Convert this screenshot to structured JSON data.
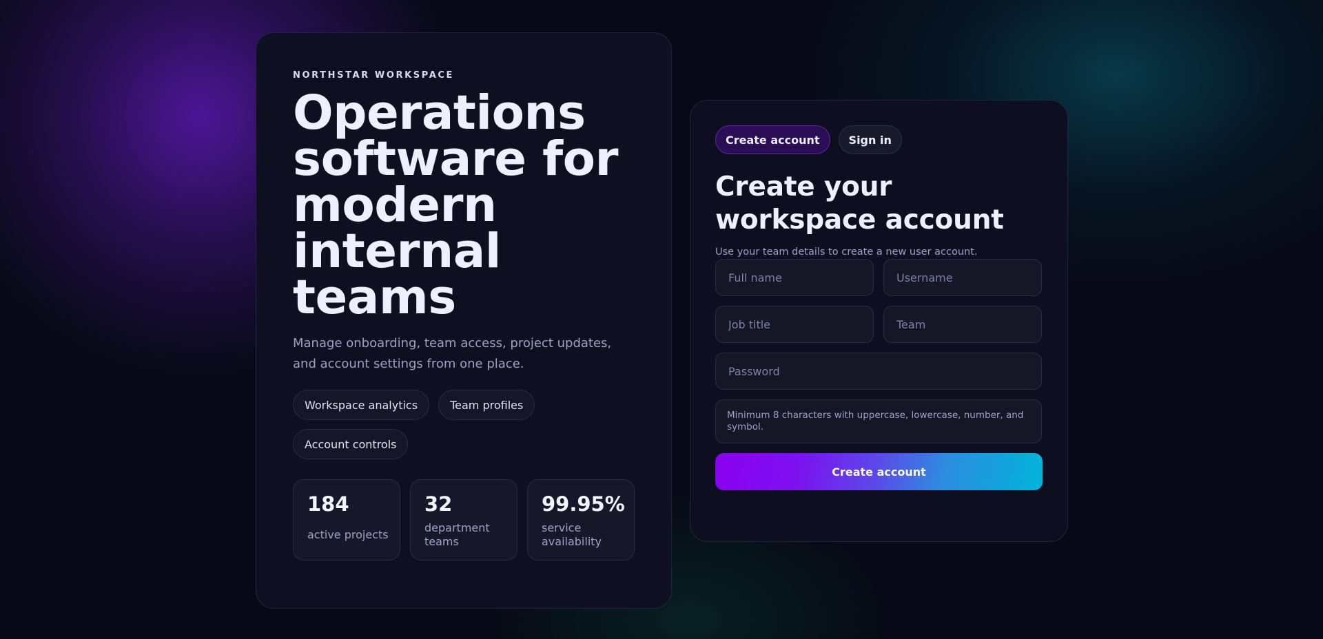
{
  "hero": {
    "eyebrow": "NORTHSTAR WORKSPACE",
    "title": "Operations software for modern internal teams",
    "description": "Manage onboarding, team access, project updates, and account settings from one place.",
    "chips": [
      {
        "label": "Workspace analytics"
      },
      {
        "label": "Team profiles"
      },
      {
        "label": "Account controls"
      }
    ],
    "stats": [
      {
        "value": "184",
        "label": "active projects"
      },
      {
        "value": "32",
        "label": "department teams"
      },
      {
        "value": "99.95%",
        "label": "service availability"
      }
    ]
  },
  "auth": {
    "tabs": [
      {
        "label": "Create account",
        "active": true
      },
      {
        "label": "Sign in",
        "active": false
      }
    ],
    "title": "Create your workspace account",
    "subtitle": "Use your team details to create a new user account.",
    "fields": {
      "full_name": {
        "placeholder": "Full name",
        "value": ""
      },
      "username": {
        "placeholder": "Username",
        "value": ""
      },
      "job_title": {
        "placeholder": "Job title",
        "value": ""
      },
      "team": {
        "placeholder": "Team",
        "value": ""
      },
      "password": {
        "placeholder": "Password",
        "value": ""
      }
    },
    "password_hint": "Minimum 8 characters with uppercase, lowercase, number, and symbol.",
    "submit_label": "Create account"
  },
  "colors": {
    "accent_start": "#8a00f0",
    "accent_end": "#00b4d8",
    "card_bg": "#0e0f21",
    "text_primary": "#eef0ff",
    "text_muted": "#9da2c5"
  }
}
